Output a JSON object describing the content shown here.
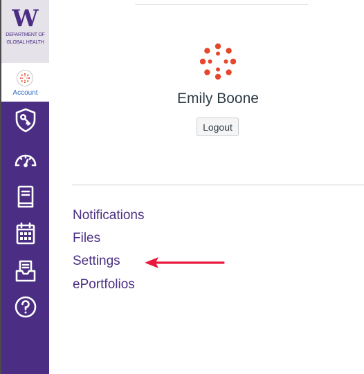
{
  "branding": {
    "logo_letter": "W",
    "department_line1": "Department of",
    "department_line2": "Global Health"
  },
  "sidebar": {
    "account_label": "Account",
    "items": [
      {
        "name": "admin",
        "icon": "shield-icon"
      },
      {
        "name": "dashboard",
        "icon": "dashboard-gauge-icon"
      },
      {
        "name": "courses",
        "icon": "book-icon"
      },
      {
        "name": "calendar",
        "icon": "calendar-icon"
      },
      {
        "name": "inbox",
        "icon": "inbox-icon"
      },
      {
        "name": "help",
        "icon": "help-icon"
      }
    ]
  },
  "profile": {
    "name": "Emily Boone",
    "logout_label": "Logout"
  },
  "account_menu": {
    "links": [
      "Notifications",
      "Files",
      "Settings",
      "ePortfolios"
    ]
  },
  "annotation": {
    "arrow_color": "#e8193c",
    "points_to": "Settings"
  },
  "colors": {
    "sidebar": "#4b2e83",
    "link": "#4b2e83",
    "canvas_red": "#e4472b"
  }
}
